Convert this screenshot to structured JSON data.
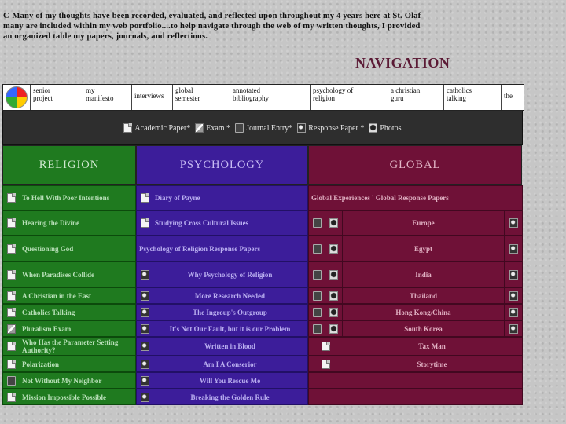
{
  "intro": {
    "line1": "C-Many of my thoughts have been recorded, evaluated, and reflected upon throughout my 4 years here at St. Olaf--",
    "line2": "many are included within my web portfolio....to help navigate through the web of my written thoughts, I provided",
    "line3": "an organized table my papers, journals, and reflections."
  },
  "nav_title": "NAVIGATION",
  "top_links": [
    {
      "label": "senior\nproject"
    },
    {
      "label": "my\nmanifesto"
    },
    {
      "label": "interviews"
    },
    {
      "label": "global\nsemester"
    },
    {
      "label": "annotated\nbibliography"
    },
    {
      "label": "psychology of\nreligion"
    },
    {
      "label": "a christian\nguru"
    },
    {
      "label": "catholics\ntalking"
    },
    {
      "label": "the"
    }
  ],
  "legend": {
    "academic": "Academic Paper*",
    "exam": "Exam *",
    "journal": "Journal Entry*",
    "response": "Response Paper *",
    "photos": "Photos"
  },
  "categories": {
    "religion": "RELIGION",
    "psychology": "PSYCHOLOGY",
    "global": "GLOBAL"
  },
  "rows": [
    {
      "rel": "To Hell With Poor Intentions",
      "rel_icon": "academic-paper-icon",
      "psy": "Diary of Payne",
      "psy_icon": "academic-paper-icon",
      "glo": "Global Experiences  '  Global Response Papers",
      "glo_type": "header"
    },
    {
      "rel": "Hearing the Divine",
      "rel_icon": "academic-paper-icon",
      "psy": "Studying Cross Cultural Issues",
      "psy_icon": "academic-paper-icon",
      "glo": "Europe",
      "glo_type": "full"
    },
    {
      "rel": "Questioning God",
      "rel_icon": "academic-paper-icon",
      "psy": "Psychology of Religion Response Papers",
      "psy_icon": "",
      "glo": "Egypt",
      "glo_type": "full"
    },
    {
      "rel": "When Paradises Collide",
      "rel_icon": "academic-paper-icon",
      "psy": "Why Psychology of Religion",
      "psy_icon": "response-paper-icon",
      "glo": "India",
      "glo_type": "full"
    },
    {
      "rel": "A Christian in the East",
      "rel_icon": "academic-paper-icon",
      "psy": "More Research Needed",
      "psy_icon": "response-paper-icon",
      "glo": "Thailand",
      "glo_type": "full"
    },
    {
      "rel": "Catholics Talking",
      "rel_icon": "academic-paper-icon",
      "psy": "The Ingroup's Outgroup",
      "psy_icon": "response-paper-icon",
      "glo": "Hong Kong/China",
      "glo_type": "full"
    },
    {
      "rel": "Pluralism Exam",
      "rel_icon": "exam-icon",
      "psy": "It's Not Our Fault, but it is our Problem",
      "psy_icon": "response-paper-icon",
      "glo": "South Korea",
      "glo_type": "full"
    },
    {
      "rel": "Who Has the Parameter Setting Authority?",
      "rel_icon": "academic-paper-icon",
      "psy": "Written in Blood",
      "psy_icon": "response-paper-icon",
      "glo": "Tax Man",
      "glo_type": "doc"
    },
    {
      "rel": "Polarization",
      "rel_icon": "academic-paper-icon",
      "psy": "Am I A Conserior",
      "psy_icon": "response-paper-icon",
      "glo": "Storytime",
      "glo_type": "doc"
    },
    {
      "rel": "Not Without My Neighbor",
      "rel_icon": "journal-entry-icon",
      "psy": "Will You Rescue Me",
      "psy_icon": "response-paper-icon",
      "glo": "",
      "glo_type": "empty"
    },
    {
      "rel": "Mission Impossible Possible",
      "rel_icon": "academic-paper-icon",
      "psy": "Breaking the Golden Rule",
      "psy_icon": "response-paper-icon",
      "glo": "",
      "glo_type": "empty"
    }
  ]
}
